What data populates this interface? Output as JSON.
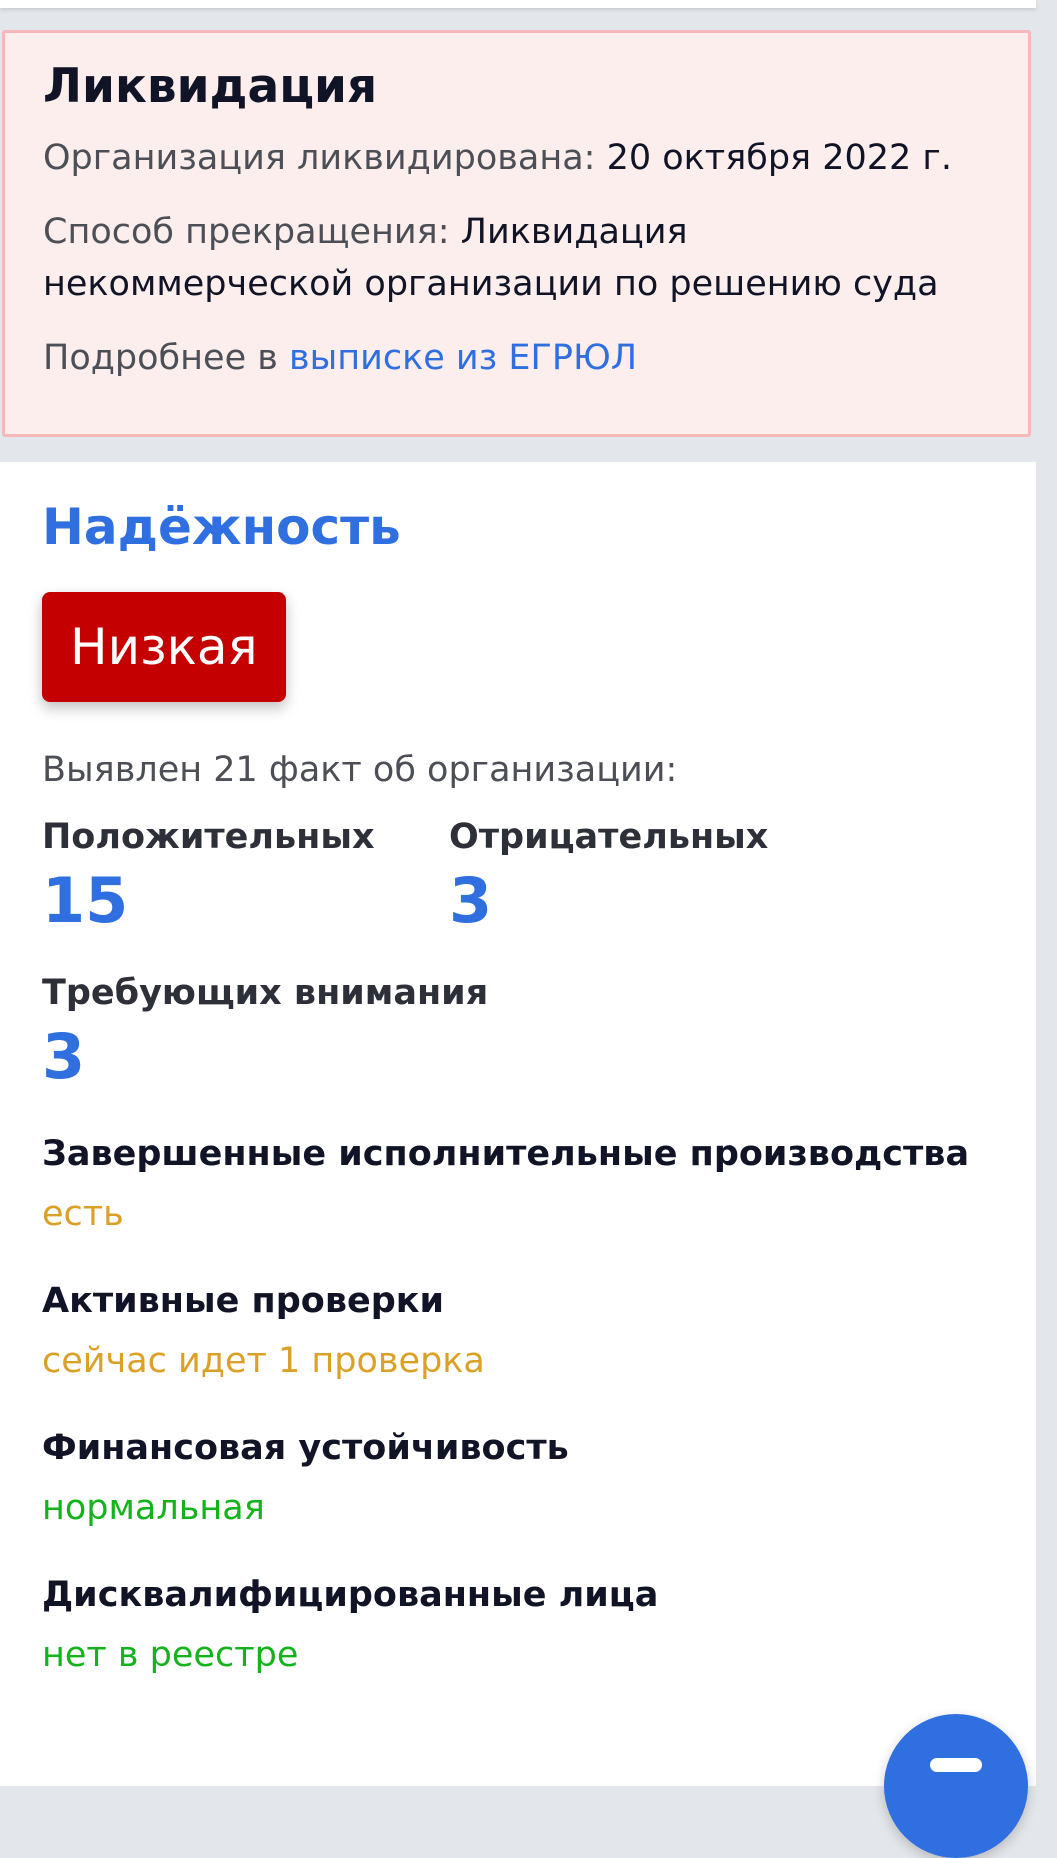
{
  "liquidation": {
    "title": "Ликвидация",
    "date_label": "Организация ликвидирована:",
    "date_value": "20 октября 2022 г.",
    "method_label": "Способ прекращения:",
    "method_value": "Ликвидация некоммерческой организации по решению суда",
    "more_prefix": "Подробнее в",
    "more_link": "выписке из ЕГРЮЛ"
  },
  "reliability": {
    "title": "Надёжность",
    "badge": "Низкая",
    "badge_color": "#c40000",
    "facts_intro": "Выявлен 21 факт об организации:",
    "stats": {
      "positive": {
        "label": "Положительных",
        "value": "15"
      },
      "negative": {
        "label": "Отрицательных",
        "value": "3"
      },
      "attention": {
        "label": "Требующих внимания",
        "value": "3"
      }
    },
    "items": [
      {
        "label": "Завершенные исполнительные производства",
        "value": "есть",
        "status": "warn"
      },
      {
        "label": "Активные проверки",
        "value": "сейчас идет 1 проверка",
        "status": "warn"
      },
      {
        "label": "Финансовая устойчивость",
        "value": "нормальная",
        "status": "ok"
      },
      {
        "label": "Дисквалифицированные лица",
        "value": "нет в реестре",
        "status": "ok"
      }
    ]
  },
  "colors": {
    "accent": "#2f6fe0",
    "warn": "#dba126",
    "ok": "#15b31b"
  },
  "fab": {
    "icon": "chat-icon"
  }
}
